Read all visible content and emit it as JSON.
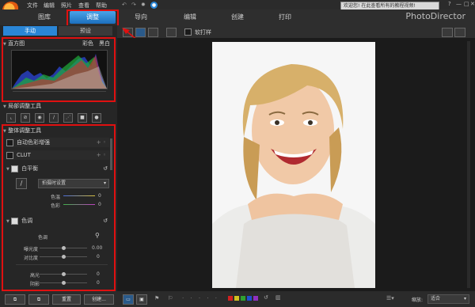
{
  "menu": {
    "items": [
      "文件",
      "编辑",
      "照片",
      "查看",
      "帮助"
    ]
  },
  "notice": "欢迎您! 在此查看所有的教程视频!",
  "window_buttons": [
    "?",
    "—",
    "□",
    "✕"
  ],
  "nav": {
    "tabs": [
      "图库",
      "调整",
      "导向",
      "编辑",
      "创建",
      "打印"
    ],
    "active": "调整"
  },
  "brand": "PhotoDirector",
  "left": {
    "subtabs": [
      "手动",
      "预设"
    ],
    "histogram": {
      "title": "直方图",
      "modes": [
        "彩色",
        "黑白"
      ]
    },
    "local_tools": {
      "title": "局部调整工具"
    },
    "global_tools": {
      "title": "整体调整工具",
      "auto_color": "自动色彩增强",
      "clut": "CLUT",
      "white_balance": {
        "title": "白平衡",
        "preset": "拍摄时设置",
        "temp_label": "色温",
        "temp_value": "0",
        "tint_label": "色彩",
        "tint_value": "0"
      },
      "tone": {
        "title": "色调",
        "subtitle": "色调",
        "exposure_label": "曝光度",
        "exposure_value": "0.00",
        "contrast_label": "对比度",
        "contrast_value": "0",
        "highlight_label": "高光",
        "highlight_value": "0",
        "shadow_label": "阴影",
        "shadow_value": "0"
      }
    }
  },
  "toolbar": {
    "softproof": "软打样"
  },
  "bottom": {
    "buttons": [
      "",
      "",
      "重置",
      "创建..."
    ],
    "zoom_label": "缩放:",
    "zoom_value": "适合"
  },
  "colors": {
    "accent": "#2a86d6",
    "annotation": "#e01010"
  }
}
